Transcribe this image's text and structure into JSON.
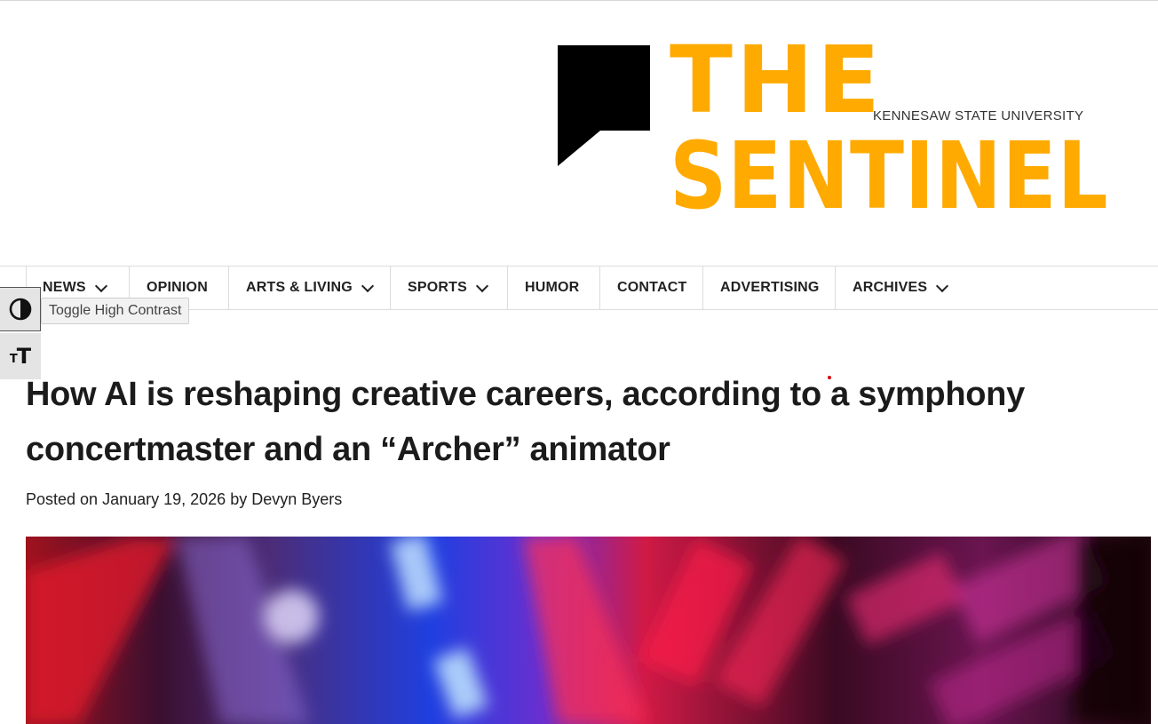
{
  "logo": {
    "word_1": "THE",
    "word_2": "SENTINEL",
    "university": "KENNESAW STATE UNIVERSITY",
    "brand_color": "#ffaa00",
    "icon": "speech-bubble-icon"
  },
  "nav": {
    "items": [
      {
        "label": "NEWS",
        "has_dropdown": true
      },
      {
        "label": "OPINION",
        "has_dropdown": false
      },
      {
        "label": "ARTS & LIVING",
        "has_dropdown": true
      },
      {
        "label": "SPORTS",
        "has_dropdown": true
      },
      {
        "label": "HUMOR",
        "has_dropdown": false
      },
      {
        "label": "CONTACT",
        "has_dropdown": false
      },
      {
        "label": "ADVERTISING",
        "has_dropdown": false
      },
      {
        "label": "ARCHIVES",
        "has_dropdown": true
      }
    ]
  },
  "accessibility": {
    "contrast_icon": "contrast-icon",
    "tooltip": "Toggle High Contrast",
    "font_icon": "font-size-icon"
  },
  "article": {
    "title": "How AI is reshaping creative careers, according to a symphony concertmaster and an “Archer” animator",
    "byline_prefix": "Posted on",
    "date": "January 19, 2026",
    "byline_by": "by",
    "author": "Devyn Byers"
  }
}
